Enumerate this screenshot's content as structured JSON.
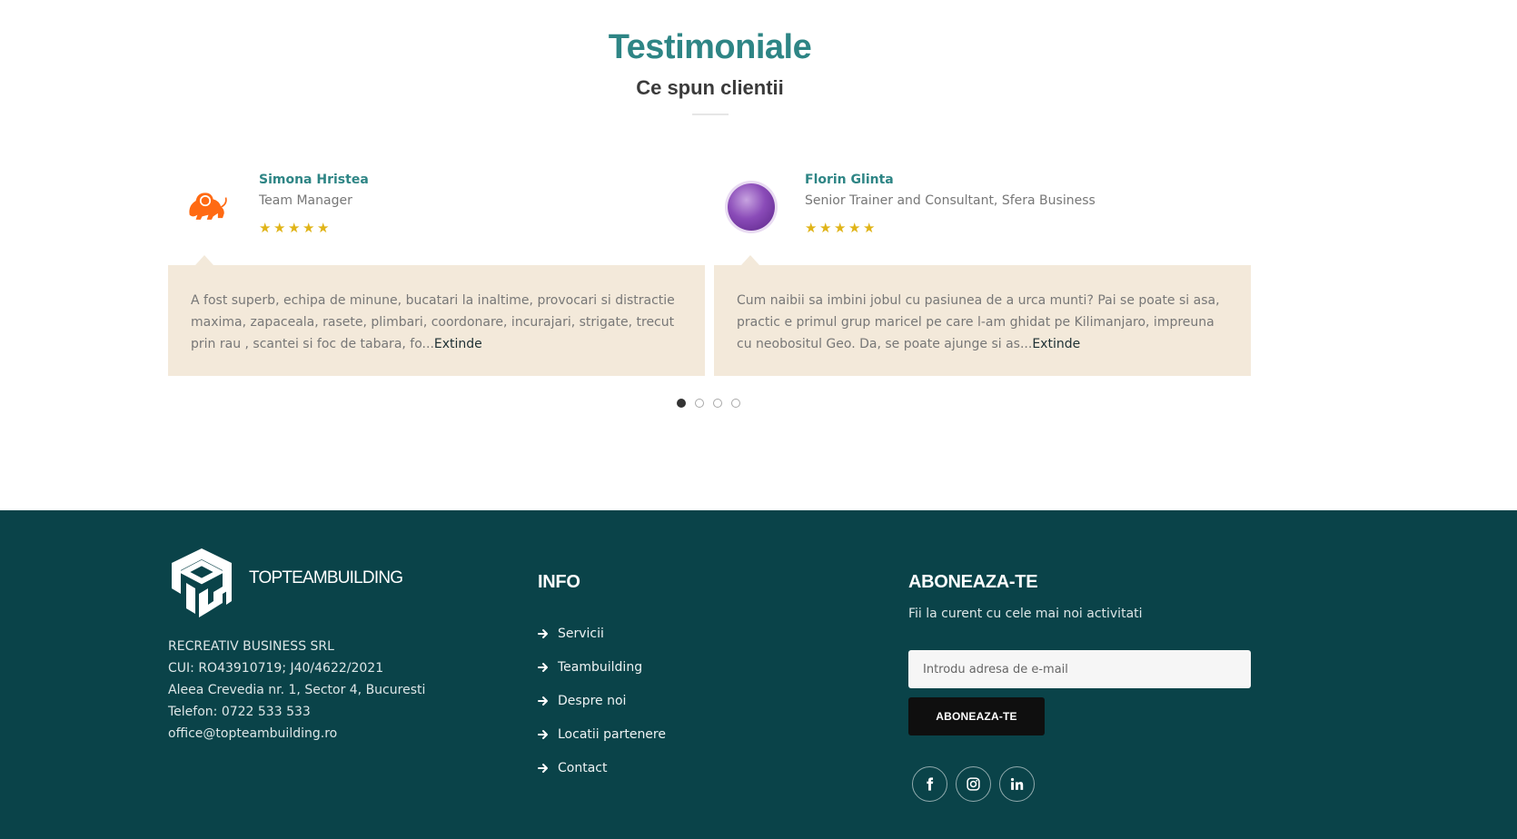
{
  "testimonials": {
    "title": "Testimoniale",
    "subtitle": "Ce spun clientii",
    "items": [
      {
        "name": "Simona Hristea",
        "role": "Team Manager",
        "rating": 5,
        "text": "A fost superb, echipa de minune, bucatari la inaltime, provocari si distractie maxima, zapaceala, rasete, plimbari, coordonare, incurajari, strigate, trecut prin rau , scantei si foc de tabara, fo...",
        "more": "Extinde",
        "avatar_icon": "lion-logo-icon"
      },
      {
        "name": "Florin Glinta",
        "role": "Senior Trainer and Consultant, Sfera Business",
        "rating": 5,
        "text": "Cum naibii sa imbini jobul cu pasiunea de a urca munti? Pai se poate si asa, practic e primul grup maricel pe care l-am ghidat pe Kilimanjaro, impreuna cu neobositul Geo. Da, se poate ajunge si as...",
        "more": "Extinde",
        "avatar_icon": "sphere-logo-icon"
      }
    ],
    "pagination": {
      "pages": 4,
      "active": 1
    }
  },
  "footer": {
    "brand": "TOPTEAMBUILDING",
    "company": {
      "name": "RECREATIV BUSINESS SRL",
      "cui": "CUI: RO43910719; J40/4622/2021",
      "address": "Aleea Crevedia nr. 1, Sector 4, Bucuresti",
      "phone": "Telefon: 0722 533 533",
      "email": "office@topteambuilding.ro"
    },
    "info": {
      "title": "INFO",
      "links": [
        "Servicii",
        "Teambuilding",
        "Despre noi",
        "Locatii partenere",
        "Contact"
      ]
    },
    "subscribe": {
      "title": "ABONEAZA-TE",
      "text": "Fii la curent cu cele mai noi activitati",
      "placeholder": "Introdu adresa de e-mail",
      "button": "ABONEAZA-TE"
    },
    "social": [
      "facebook-icon",
      "instagram-icon",
      "linkedin-icon"
    ]
  },
  "colors": {
    "accent": "#2e8585",
    "footer_bg": "#0a4349",
    "quote_bg": "#f3e9da",
    "star": "#e0b418"
  }
}
